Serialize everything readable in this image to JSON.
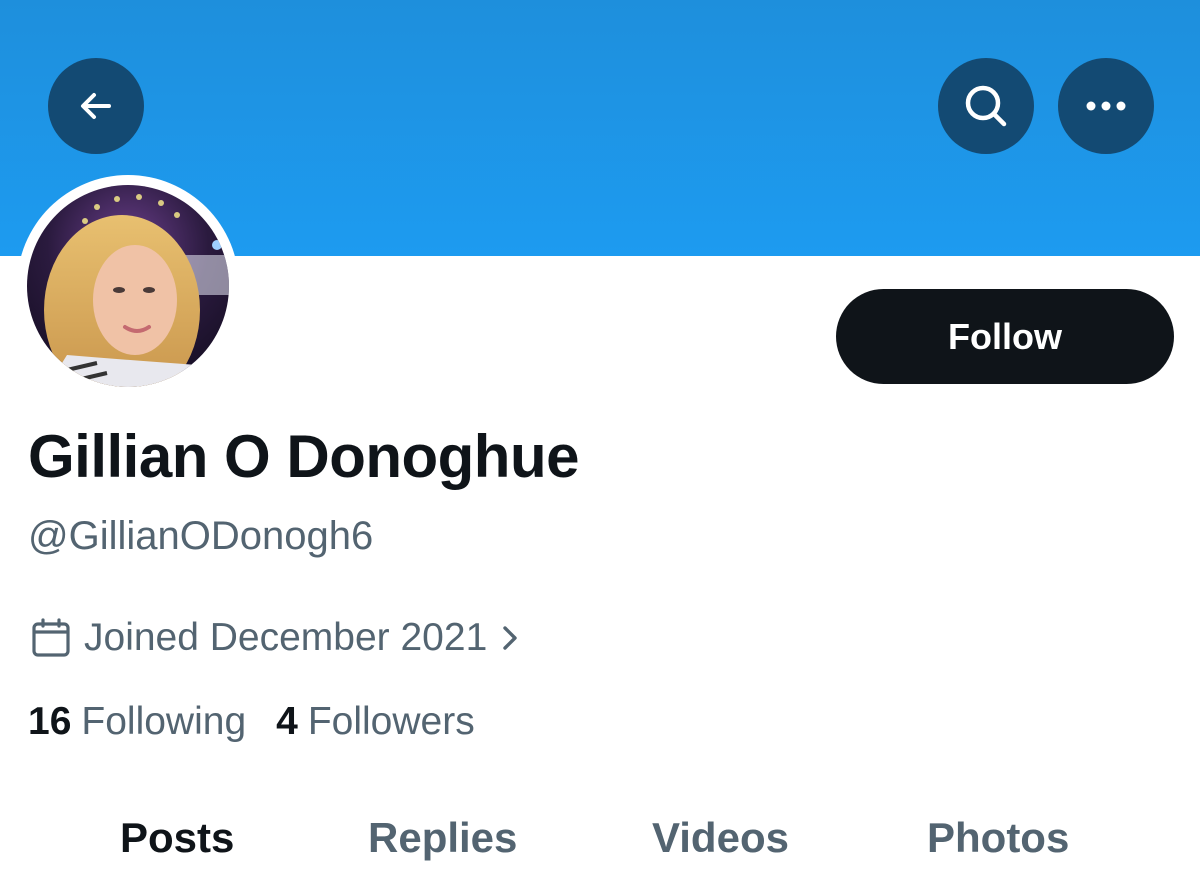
{
  "header": {
    "back_icon": "arrow-left-icon",
    "search_icon": "search-icon",
    "more_icon": "ellipsis-icon",
    "banner_color": "#1d9bf0",
    "button_color": "#134a73"
  },
  "profile": {
    "display_name": "Gillian O Donoghue",
    "handle": "@GillianODonogh6",
    "joined": "Joined December 2021",
    "joined_icon": "calendar-icon",
    "follow_label": "Follow"
  },
  "stats": {
    "following_count": "16",
    "following_label": "Following",
    "followers_count": "4",
    "followers_label": "Followers"
  },
  "tabs": [
    {
      "label": "Posts",
      "active": true
    },
    {
      "label": "Replies",
      "active": false
    },
    {
      "label": "Videos",
      "active": false
    },
    {
      "label": "Photos",
      "active": false
    }
  ]
}
